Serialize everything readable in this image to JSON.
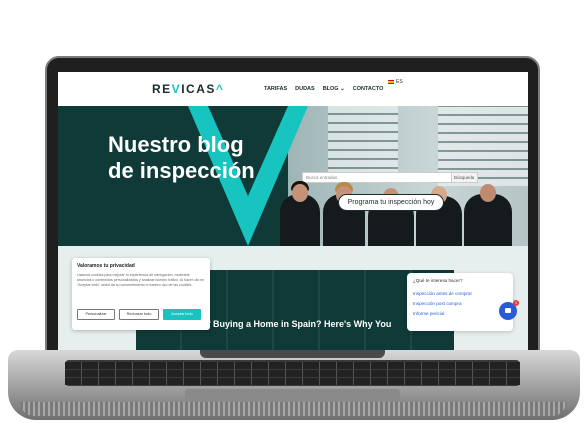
{
  "nav": {
    "logo_main": "RE",
    "logo_v": "V",
    "logo_rest": "ICAS",
    "logo_accent": "^",
    "items": [
      "TARIFAS",
      "DUDAS",
      "BLOG ⌄",
      "CONTACTO"
    ],
    "lang": "ES"
  },
  "hero": {
    "title_line1": "Nuestro blog",
    "title_line2": "de inspección",
    "search_placeholder": "Busca entradas",
    "search_button": "Búsqueda",
    "cta": "Programa tu inspección hoy"
  },
  "article": {
    "title": "Thinking of Buying a Home in Spain? Here's Why You"
  },
  "cookie": {
    "title": "Valoramos tu privacidad",
    "body": "Usamos cookies para mejorar tu experiencia de navegación, mostrarte anuncios o contenidos personalizados y analizar nuestro tráfico. Al hacer clic en \"Aceptar todo\" usted da su consentimiento a nuestro uso de las cookies.",
    "btn_customize": "Personalizar",
    "btn_reject": "Rechazar todo",
    "btn_accept": "Aceptar todo"
  },
  "chat": {
    "question": "¿Qué te interesa hacer?",
    "options": [
      "Inspección antes de comprar",
      "Inspección post compra",
      "Informe pericial"
    ],
    "badge": "1"
  },
  "colors": {
    "accent": "#17c4c0",
    "dark": "#0f3a37",
    "chat_blue": "#2a5bd7"
  }
}
